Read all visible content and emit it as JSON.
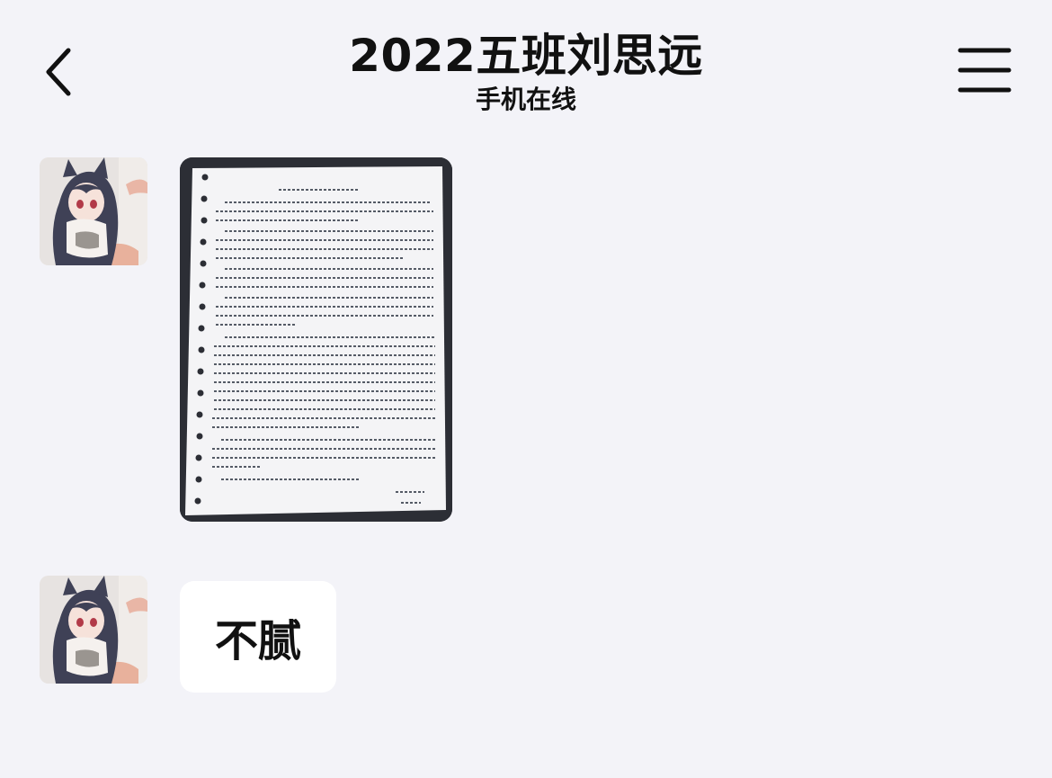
{
  "header": {
    "title": "2022五班刘思远",
    "status": "手机在线",
    "back_icon": "chevron-left-icon",
    "menu_icon": "hamburger-menu-icon"
  },
  "messages": [
    {
      "type": "image",
      "avatar": "anime-cat-girl-avatar",
      "image_description": "handwritten-essay-photo"
    },
    {
      "type": "text",
      "avatar": "anime-cat-girl-avatar",
      "text": "不腻"
    }
  ],
  "colors": {
    "background": "#f3f3f8",
    "bubble": "#ffffff",
    "text": "#111111"
  }
}
